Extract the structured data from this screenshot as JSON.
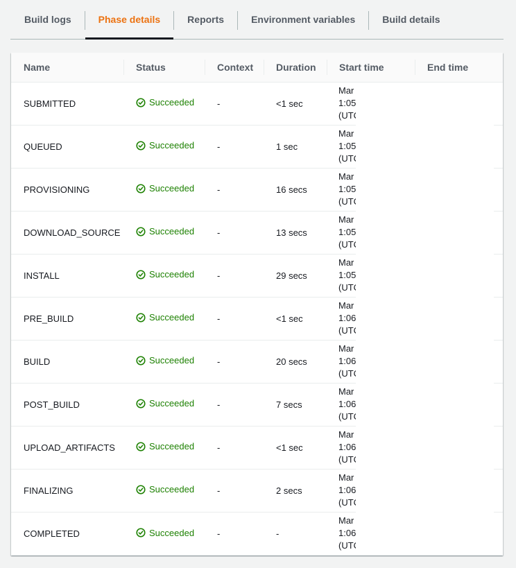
{
  "tabs": [
    {
      "label": "Build logs",
      "active": false
    },
    {
      "label": "Phase details",
      "active": true
    },
    {
      "label": "Reports",
      "active": false
    },
    {
      "label": "Environment variables",
      "active": false
    },
    {
      "label": "Build details",
      "active": false
    }
  ],
  "table": {
    "columns": [
      "Name",
      "Status",
      "Context",
      "Duration",
      "Start time",
      "End time"
    ],
    "rows": [
      {
        "name": "SUBMITTED",
        "status": "Succeeded",
        "context": "-",
        "duration": "<1 sec",
        "start_time": [
          "Mar",
          "1:05",
          "(UTC"
        ],
        "end_time": ""
      },
      {
        "name": "QUEUED",
        "status": "Succeeded",
        "context": "-",
        "duration": "1 sec",
        "start_time": [
          "Mar",
          "1:05",
          "(UTC"
        ],
        "end_time": ""
      },
      {
        "name": "PROVISIONING",
        "status": "Succeeded",
        "context": "-",
        "duration": "16 secs",
        "start_time": [
          "Mar",
          "1:05",
          "(UTC"
        ],
        "end_time": ""
      },
      {
        "name": "DOWNLOAD_SOURCE",
        "status": "Succeeded",
        "context": "-",
        "duration": "13 secs",
        "start_time": [
          "Mar",
          "1:05",
          "(UTC"
        ],
        "end_time": ""
      },
      {
        "name": "INSTALL",
        "status": "Succeeded",
        "context": "-",
        "duration": "29 secs",
        "start_time": [
          "Mar",
          "1:05",
          "(UTC"
        ],
        "end_time": ""
      },
      {
        "name": "PRE_BUILD",
        "status": "Succeeded",
        "context": "-",
        "duration": "<1 sec",
        "start_time": [
          "Mar",
          "1:06",
          "(UTC"
        ],
        "end_time": ""
      },
      {
        "name": "BUILD",
        "status": "Succeeded",
        "context": "-",
        "duration": "20 secs",
        "start_time": [
          "Mar",
          "1:06",
          "(UTC"
        ],
        "end_time": ""
      },
      {
        "name": "POST_BUILD",
        "status": "Succeeded",
        "context": "-",
        "duration": "7 secs",
        "start_time": [
          "Mar",
          "1:06",
          "(UTC"
        ],
        "end_time": ""
      },
      {
        "name": "UPLOAD_ARTIFACTS",
        "status": "Succeeded",
        "context": "-",
        "duration": "<1 sec",
        "start_time": [
          "Mar",
          "1:06",
          "(UTC"
        ],
        "end_time": ""
      },
      {
        "name": "FINALIZING",
        "status": "Succeeded",
        "context": "-",
        "duration": "2 secs",
        "start_time": [
          "Mar",
          "1:06",
          "(UTC"
        ],
        "end_time": ""
      },
      {
        "name": "COMPLETED",
        "status": "Succeeded",
        "context": "-",
        "duration": "-",
        "start_time": [
          "Mar",
          "1:06",
          "(UTC"
        ],
        "end_time": ""
      }
    ]
  },
  "status_icon": "check-circle-icon",
  "colors": {
    "accent": "#ec7211",
    "success": "#1d8102",
    "tab_text": "#545b64",
    "active_underline": "#16191f",
    "background": "#f2f3f3"
  }
}
